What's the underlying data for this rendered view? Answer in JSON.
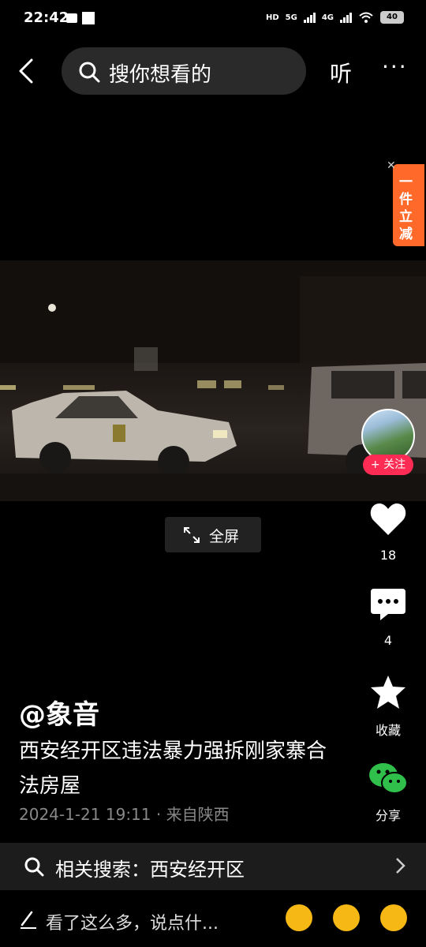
{
  "status": {
    "time": "22:42",
    "hd": "HD",
    "net1": "5G",
    "net2": "4G",
    "battery": "40"
  },
  "top": {
    "search_placeholder": "搜你想看的",
    "listen": "听",
    "more": "···"
  },
  "promo": {
    "text": "一件立减"
  },
  "video": {
    "fullscreen_label": "全屏"
  },
  "side": {
    "follow": "+ 关注",
    "likes": "18",
    "comments": "4",
    "favorite": "收藏",
    "share": "分享"
  },
  "post": {
    "author": "@象音",
    "description": "西安经开区违法暴力强拆刚家寨合法房屋",
    "date": "2024-1-21 19:11",
    "location": " · 来自陕西"
  },
  "related": {
    "label": "相关搜索：西安经开区"
  },
  "comment": {
    "placeholder": "看了这么多，说点什..."
  },
  "colors": {
    "accent": "#fe2c55",
    "promo": "#ff6a2a",
    "share_green": "#2fbf4a"
  }
}
